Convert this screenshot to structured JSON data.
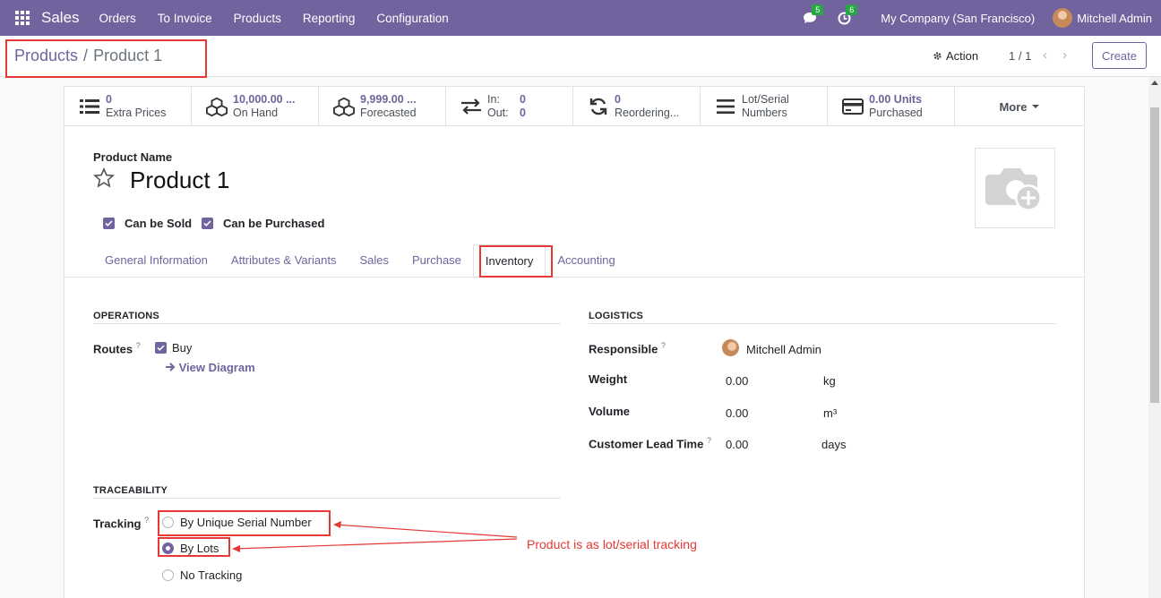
{
  "navbar": {
    "brand": "Sales",
    "menu": [
      "Orders",
      "To Invoice",
      "Products",
      "Reporting",
      "Configuration"
    ],
    "messages_count": "5",
    "activities_count": "6",
    "company": "My Company (San Francisco)",
    "user": "Mitchell Admin"
  },
  "control": {
    "breadcrumb_parent": "Products",
    "breadcrumb_sep": "/",
    "breadcrumb_current": "Product 1",
    "action_label": "Action",
    "pager": "1 / 1",
    "create_label": "Create"
  },
  "stats": {
    "extra_prices_value": "0",
    "extra_prices_label": "Extra Prices",
    "on_hand_value": "10,000.00 ...",
    "on_hand_label": "On Hand",
    "forecasted_value": "9,999.00 ...",
    "forecasted_label": "Forecasted",
    "in_label": "In:",
    "in_value": "0",
    "out_label": "Out:",
    "out_value": "0",
    "reordering_value": "0",
    "reordering_label": "Reordering...",
    "lot_label_1": "Lot/Serial",
    "lot_label_2": "Numbers",
    "purchased_value": "0.00 Units",
    "purchased_label": "Purchased",
    "more_label": "More"
  },
  "product": {
    "name_label": "Product Name",
    "name": "Product 1",
    "can_be_sold": "Can be Sold",
    "can_be_purchased": "Can be Purchased"
  },
  "tabs": [
    "General Information",
    "Attributes & Variants",
    "Sales",
    "Purchase",
    "Inventory",
    "Accounting"
  ],
  "operations": {
    "title": "OPERATIONS",
    "routes_label": "Routes",
    "route_buy": "Buy",
    "view_diagram": "View Diagram"
  },
  "logistics": {
    "title": "LOGISTICS",
    "responsible_label": "Responsible",
    "responsible_value": "Mitchell Admin",
    "weight_label": "Weight",
    "weight_value": "0.00",
    "weight_unit": "kg",
    "volume_label": "Volume",
    "volume_value": "0.00",
    "volume_unit": "m³",
    "lead_label": "Customer Lead Time",
    "lead_value": "0.00",
    "lead_unit": "days"
  },
  "traceability": {
    "title": "TRACEABILITY",
    "tracking_label": "Tracking",
    "options": [
      "By Unique Serial Number",
      "By Lots",
      "No Tracking"
    ],
    "selected": "By Lots"
  },
  "annotation": {
    "text": "Product is as lot/serial tracking"
  },
  "colors": {
    "primary": "#71639e",
    "annotation_red": "#e53935",
    "badge_green": "#28a745"
  }
}
